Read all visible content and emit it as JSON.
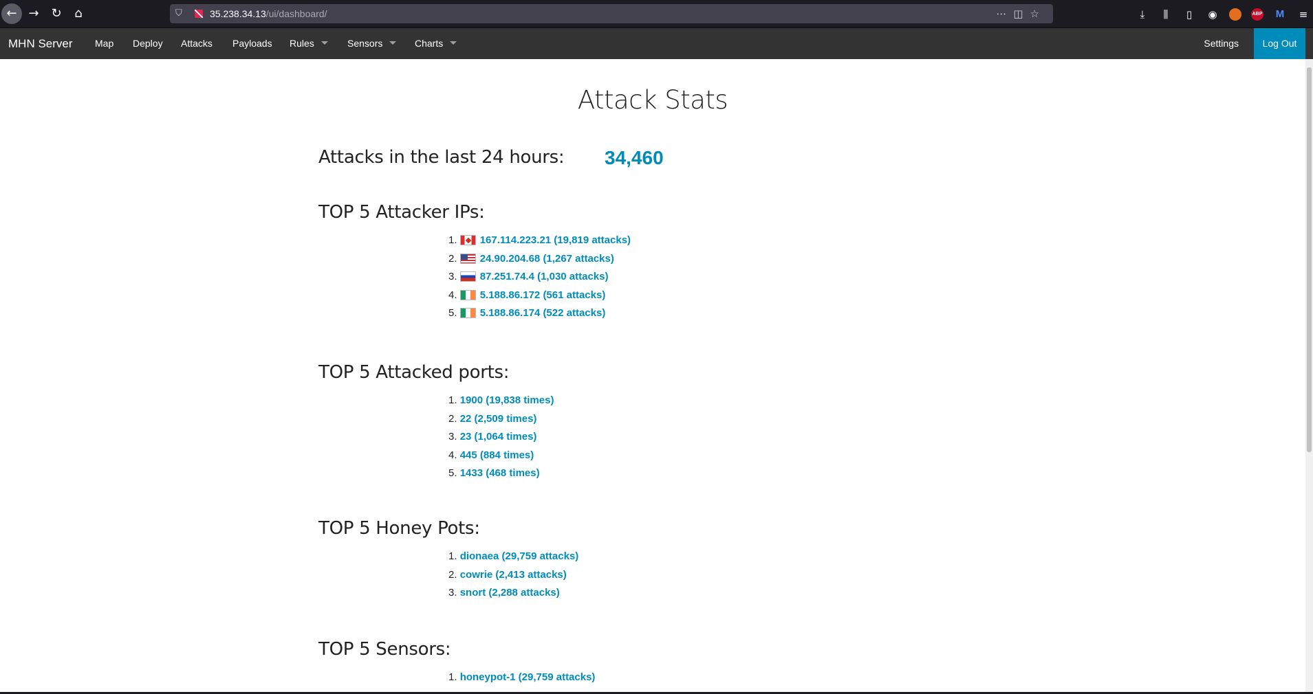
{
  "browser": {
    "url_host": "35.238.34.13",
    "url_path": "/ui/dashboard/"
  },
  "navbar": {
    "brand": "MHN Server",
    "items": [
      {
        "label": "Map",
        "dropdown": false
      },
      {
        "label": "Deploy",
        "dropdown": false
      },
      {
        "label": "Attacks",
        "dropdown": false
      },
      {
        "label": "Payloads",
        "dropdown": false
      },
      {
        "label": "Rules",
        "dropdown": true
      },
      {
        "label": "Sensors",
        "dropdown": true
      },
      {
        "label": "Charts",
        "dropdown": true
      }
    ],
    "settings_label": "Settings",
    "logout_label": "Log Out",
    "accent_color": "#008cba"
  },
  "page": {
    "title": "Attack Stats",
    "attacks_24h_label": "Attacks in the last 24 hours:",
    "attacks_24h_value": "34,460",
    "top_ips": {
      "heading": "TOP 5 Attacker IPs:",
      "items": [
        {
          "num": "1.",
          "flag": "canada-flag-icon",
          "text": "167.114.223.21 (19,819 attacks)"
        },
        {
          "num": "2.",
          "flag": "usa-flag-icon",
          "text": "24.90.204.68 (1,267 attacks)"
        },
        {
          "num": "3.",
          "flag": "russia-flag-icon",
          "text": "87.251.74.4 (1,030 attacks)"
        },
        {
          "num": "4.",
          "flag": "ireland-flag-icon",
          "text": "5.188.86.172 (561 attacks)"
        },
        {
          "num": "5.",
          "flag": "ireland-flag-icon",
          "text": "5.188.86.174 (522 attacks)"
        }
      ]
    },
    "top_ports": {
      "heading": "TOP 5 Attacked ports:",
      "items": [
        {
          "num": "1.",
          "text": "1900 (19,838 times)"
        },
        {
          "num": "2.",
          "text": "22 (2,509 times)"
        },
        {
          "num": "3.",
          "text": "23 (1,064 times)"
        },
        {
          "num": "4.",
          "text": "445 (884 times)"
        },
        {
          "num": "5.",
          "text": "1433 (468 times)"
        }
      ]
    },
    "top_honeypots": {
      "heading": "TOP 5 Honey Pots:",
      "items": [
        {
          "num": "1.",
          "text": "dionaea (29,759 attacks)"
        },
        {
          "num": "2.",
          "text": "cowrie (2,413 attacks)"
        },
        {
          "num": "3.",
          "text": "snort (2,288 attacks)"
        }
      ]
    },
    "top_sensors": {
      "heading": "TOP 5 Sensors:",
      "items": [
        {
          "num": "1.",
          "text": "honeypot-1 (29,759 attacks)"
        }
      ]
    }
  }
}
